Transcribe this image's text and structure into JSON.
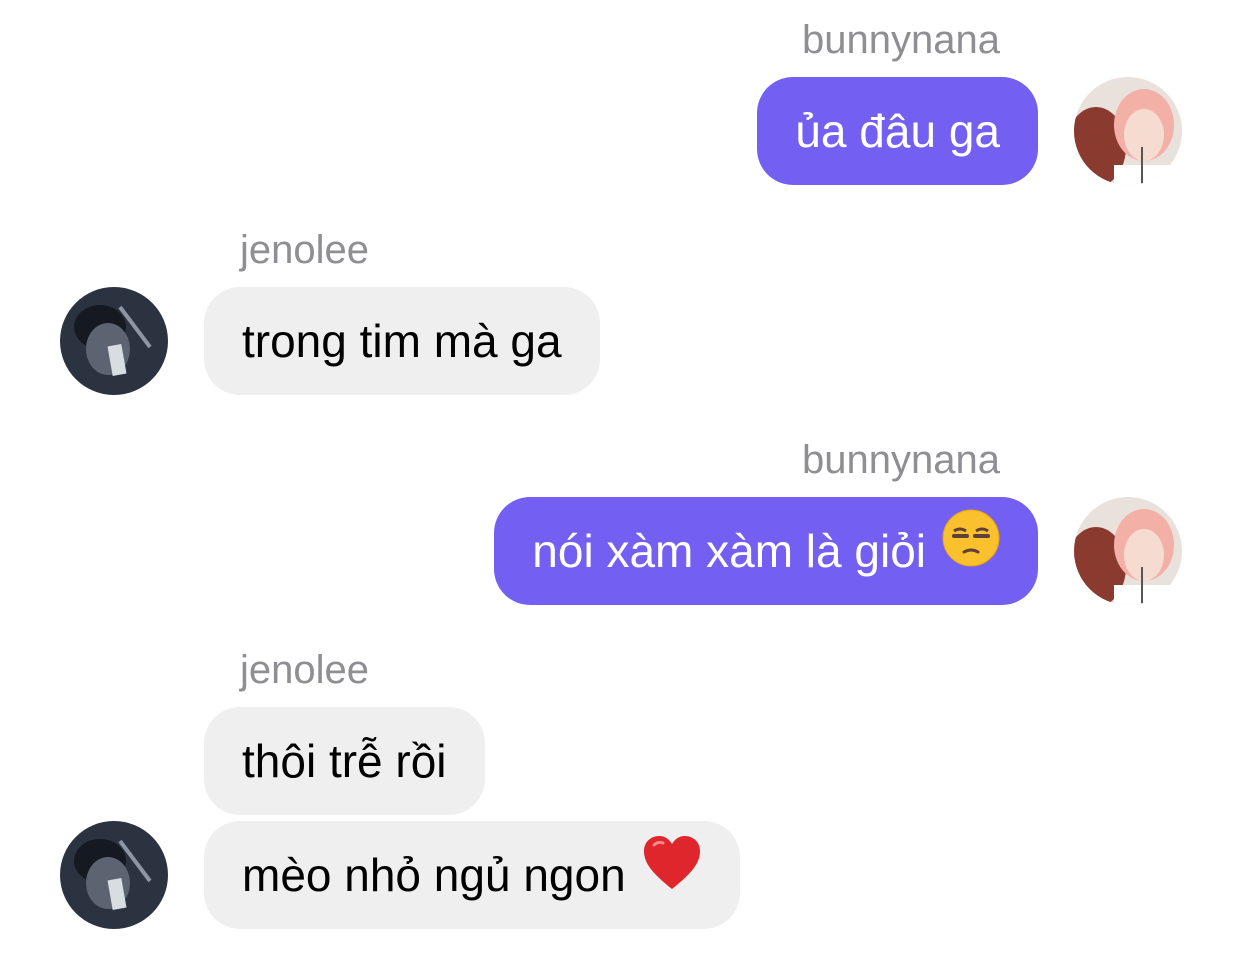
{
  "conversation": {
    "messages": [
      {
        "sender": "bunnynana",
        "text": "ủa đâu ga",
        "direction": "outgoing"
      },
      {
        "sender": "jenolee",
        "text": "trong tim mà ga",
        "direction": "incoming"
      },
      {
        "sender": "bunnynana",
        "text": "nói xàm xàm là giỏi",
        "emoji": "unamused-face-icon",
        "direction": "outgoing"
      },
      {
        "sender": "jenolee",
        "text": "thôi trễ rồi",
        "direction": "incoming"
      },
      {
        "sender": "jenolee",
        "text": "mèo nhỏ ngủ ngon",
        "emoji": "red-heart-icon",
        "direction": "incoming"
      }
    ]
  },
  "colors": {
    "outgoing_bubble": "#7360f2",
    "incoming_bubble": "#efefef",
    "sender_name": "#8e8e93"
  }
}
